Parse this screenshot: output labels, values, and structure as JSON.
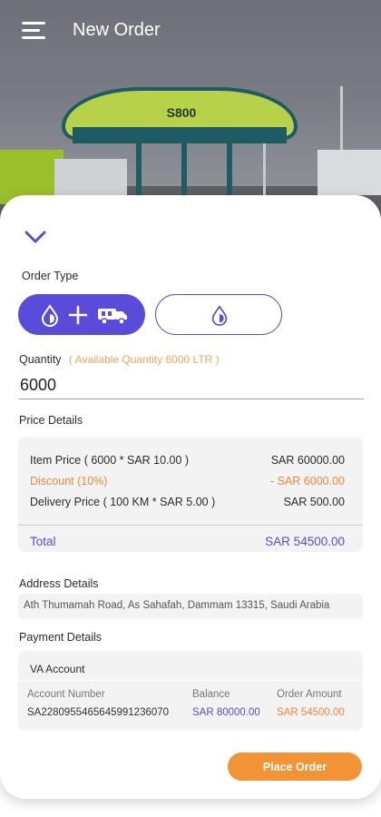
{
  "app": {
    "title": "New Order"
  },
  "hero": {
    "sign_text": "S800"
  },
  "order_type": {
    "label": "Order Type",
    "options": [
      {
        "name": "fuel-plus-delivery",
        "icons": [
          "drop-icon",
          "plus-icon",
          "truck-icon"
        ],
        "selected": true
      },
      {
        "name": "fuel-only",
        "icons": [
          "drop-icon"
        ],
        "selected": false
      }
    ]
  },
  "quantity": {
    "label": "Quantity",
    "available": "( Available Quantity 6000 LTR )",
    "value": "6000"
  },
  "price_details": {
    "label": "Price Details",
    "rows": [
      {
        "label": "Item Price ( 6000 * SAR 10.00 )",
        "value": "SAR 60000.00"
      },
      {
        "label": "Discount (10%)",
        "value": "- SAR 6000.00"
      },
      {
        "label": "Delivery Price ( 100 KM * SAR 5.00 )",
        "value": "SAR 500.00"
      }
    ],
    "total_label": "Total",
    "total_value": "SAR 54500.00"
  },
  "address": {
    "label": "Address Details",
    "value": "Ath Thumamah Road, As Sahafah, Dammam 13315, Saudi Arabia"
  },
  "payment": {
    "label": "Payment Details",
    "method": "VA Account",
    "account_number_label": "Account Number",
    "account_number": "SA2280955465645991236070",
    "balance_label": "Balance",
    "balance": "SAR 80000.00",
    "order_amount_label": "Order Amount",
    "order_amount": "SAR 54500.00"
  },
  "actions": {
    "place_order": "Place Order"
  },
  "colors": {
    "primary": "#5a4bd8",
    "accent": "#f29436",
    "discount": "#f0863d"
  }
}
